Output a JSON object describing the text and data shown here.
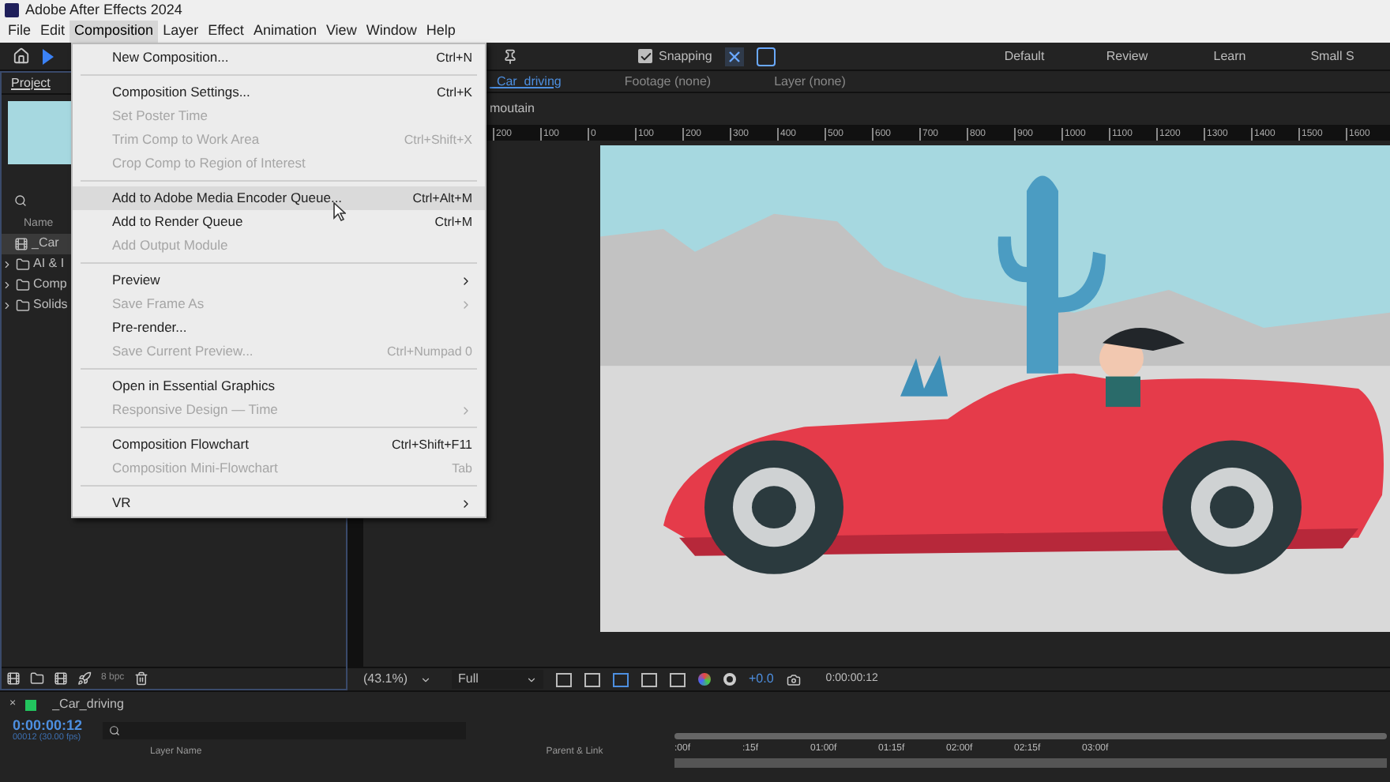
{
  "window": {
    "title": "Adobe After Effects 2024"
  },
  "menubar": [
    {
      "label": "File",
      "selected": false
    },
    {
      "label": "Edit",
      "selected": false
    },
    {
      "label": "Composition",
      "selected": true
    },
    {
      "label": "Layer",
      "selected": false
    },
    {
      "label": "Effect",
      "selected": false
    },
    {
      "label": "Animation",
      "selected": false
    },
    {
      "label": "View",
      "selected": false
    },
    {
      "label": "Window",
      "selected": false
    },
    {
      "label": "Help",
      "selected": false
    }
  ],
  "toolbar": {
    "snapping": {
      "label": "Snapping",
      "checked": true
    },
    "workspaces": [
      "Default",
      "Review",
      "Learn",
      "Small S"
    ]
  },
  "project_panel": {
    "tab": "Project",
    "column": "Name",
    "items": [
      {
        "name": "_Car",
        "kind": "comp",
        "selected": true
      },
      {
        "name": "AI & I",
        "kind": "folder",
        "selected": false
      },
      {
        "name": "Comp",
        "kind": "folder",
        "selected": false
      },
      {
        "name": "Solids",
        "kind": "folder",
        "selected": false
      }
    ],
    "bit_depth": "8 bpc"
  },
  "viewer": {
    "tabs": [
      {
        "label": "_Car_driving",
        "selected": true
      },
      {
        "label": "Footage (none)",
        "selected": false
      },
      {
        "label": "Layer (none)",
        "selected": false
      }
    ],
    "breadcrumb": "moutain",
    "ruler": [
      "200",
      "100",
      "0",
      "100",
      "200",
      "300",
      "400",
      "500",
      "600",
      "700",
      "800",
      "900",
      "1000",
      "1100",
      "1200",
      "1300",
      "1400",
      "1500",
      "1600"
    ],
    "zoom": "(43.1%)",
    "resolution": "Full",
    "exposure": "+0.0",
    "timecode": "0:00:00:12"
  },
  "timeline": {
    "close": "×",
    "comp": {
      "label": "_Car_driving",
      "color": "#22c55e"
    },
    "timecode": "0:00:00:12",
    "frame_info": "00012 (30.00 fps)",
    "columns": [
      "Layer Name",
      "Parent & Link"
    ],
    "ticks": [
      ":00f",
      ":15f",
      "01:00f",
      "01:15f",
      "02:00f",
      "02:15f",
      "03:00f"
    ]
  },
  "menu": {
    "items": [
      {
        "kind": "item",
        "label": "New Composition...",
        "shortcut": "Ctrl+N",
        "disabled": false,
        "submenu": false,
        "hovered": false
      },
      {
        "kind": "separator"
      },
      {
        "kind": "item",
        "label": "Composition Settings...",
        "shortcut": "Ctrl+K",
        "disabled": false,
        "submenu": false,
        "hovered": false
      },
      {
        "kind": "item",
        "label": "Set Poster Time",
        "disabled": true,
        "submenu": false,
        "hovered": false
      },
      {
        "kind": "item",
        "label": "Trim Comp to Work Area",
        "shortcut": "Ctrl+Shift+X",
        "disabled": true,
        "submenu": false,
        "hovered": false
      },
      {
        "kind": "item",
        "label": "Crop Comp to Region of Interest",
        "disabled": true,
        "submenu": false,
        "hovered": false
      },
      {
        "kind": "separator"
      },
      {
        "kind": "item",
        "label": "Add to Adobe Media Encoder Queue...",
        "shortcut": "Ctrl+Alt+M",
        "disabled": false,
        "submenu": false,
        "hovered": true
      },
      {
        "kind": "item",
        "label": "Add to Render Queue",
        "shortcut": "Ctrl+M",
        "disabled": false,
        "submenu": false,
        "hovered": false
      },
      {
        "kind": "item",
        "label": "Add Output Module",
        "disabled": true,
        "submenu": false,
        "hovered": false
      },
      {
        "kind": "separator"
      },
      {
        "kind": "item",
        "label": "Preview",
        "disabled": false,
        "submenu": true,
        "hovered": false
      },
      {
        "kind": "item",
        "label": "Save Frame As",
        "disabled": true,
        "submenu": true,
        "hovered": false
      },
      {
        "kind": "item",
        "label": "Pre-render...",
        "disabled": false,
        "submenu": false,
        "hovered": false
      },
      {
        "kind": "item",
        "label": "Save Current Preview...",
        "shortcut": "Ctrl+Numpad 0",
        "disabled": true,
        "submenu": false,
        "hovered": false
      },
      {
        "kind": "separator"
      },
      {
        "kind": "item",
        "label": "Open in Essential Graphics",
        "disabled": false,
        "submenu": false,
        "hovered": false
      },
      {
        "kind": "item",
        "label": "Responsive Design — Time",
        "disabled": true,
        "submenu": true,
        "hovered": false
      },
      {
        "kind": "separator"
      },
      {
        "kind": "item",
        "label": "Composition Flowchart",
        "shortcut": "Ctrl+Shift+F11",
        "disabled": false,
        "submenu": false,
        "hovered": false
      },
      {
        "kind": "item",
        "label": "Composition Mini-Flowchart",
        "shortcut": "Tab",
        "disabled": true,
        "submenu": false,
        "hovered": false
      },
      {
        "kind": "separator"
      },
      {
        "kind": "item",
        "label": "VR",
        "disabled": false,
        "submenu": true,
        "hovered": false
      }
    ]
  }
}
